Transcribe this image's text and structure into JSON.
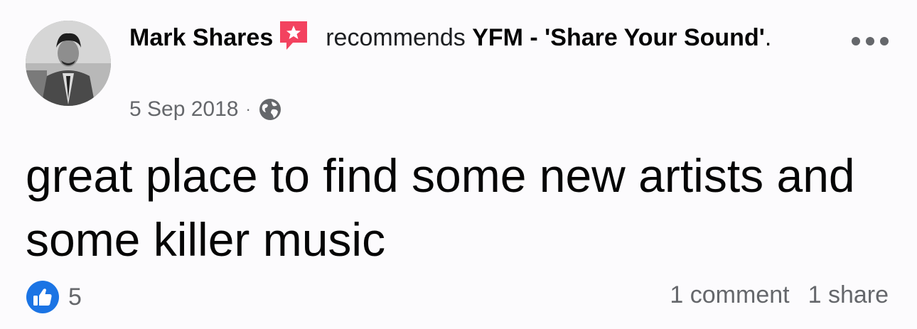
{
  "post": {
    "author": "Mark Shares",
    "recommends_word": "recommends",
    "page_name": "YFM - 'Share Your Sound'",
    "trailing_period": ".",
    "date": "5 Sep 2018",
    "separator": "·",
    "audience_icon": "globe-icon",
    "body": "great place to find some new artists and some killer music"
  },
  "engagement": {
    "reaction_icon": "like-icon",
    "reaction_count": "5",
    "comments": "1 comment",
    "shares": "1 share"
  },
  "colors": {
    "like_blue": "#1b74e4",
    "recommend_red": "#f3425f",
    "secondary_text": "#65676b"
  }
}
